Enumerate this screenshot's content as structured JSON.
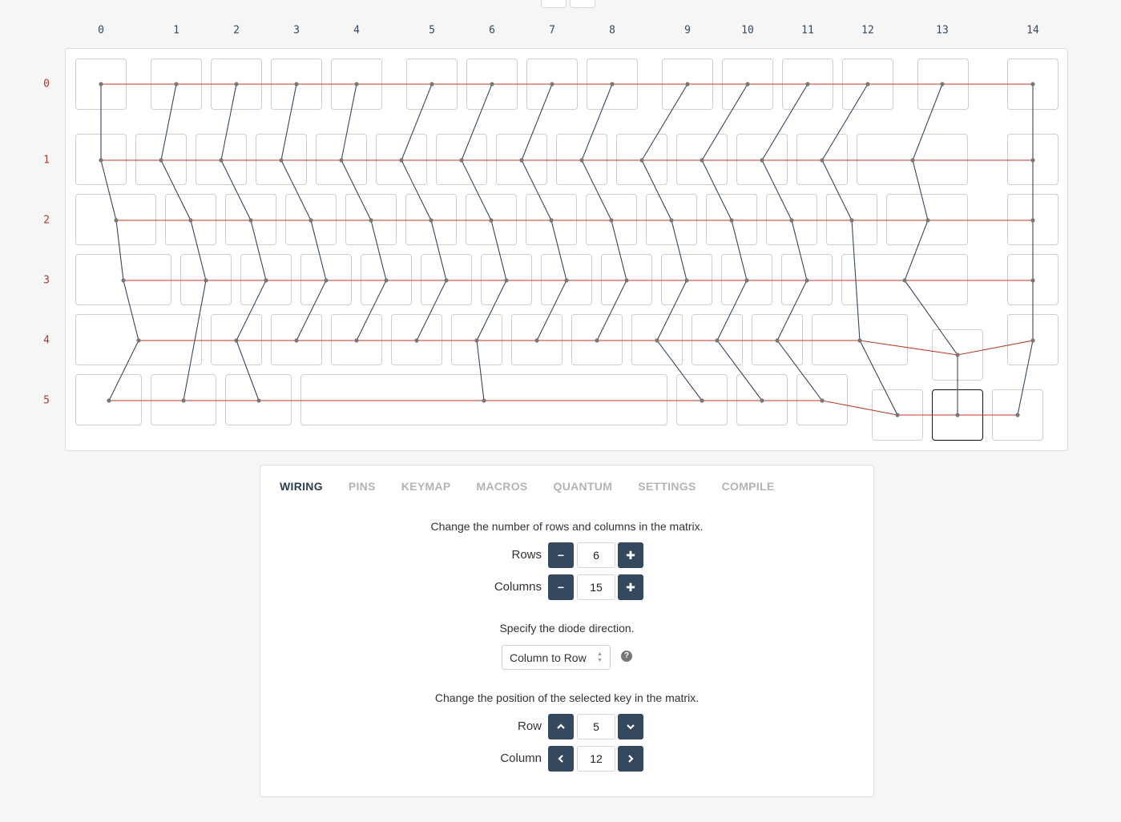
{
  "matrix": {
    "column_labels": [
      "0",
      "1",
      "2",
      "3",
      "4",
      "5",
      "6",
      "7",
      "8",
      "9",
      "10",
      "11",
      "12",
      "13",
      "14"
    ],
    "row_labels": [
      "0",
      "1",
      "2",
      "3",
      "4",
      "5"
    ]
  },
  "colors": {
    "row_wire": "#c0392b",
    "column_wire": "#34495e",
    "node": "#777777",
    "accent_button": "#34495e"
  },
  "tabs": [
    "WIRING",
    "PINS",
    "KEYMAP",
    "MACROS",
    "QUANTUM",
    "SETTINGS",
    "COMPILE"
  ],
  "active_tab": "WIRING",
  "wiring": {
    "matrix_size_text": "Change the number of rows and columns in the matrix.",
    "rows_label": "Rows",
    "rows_value": "6",
    "columns_label": "Columns",
    "columns_value": "15",
    "diode_text": "Specify the diode direction.",
    "diode_value": "Column to Row",
    "position_text": "Change the position of the selected key in the matrix.",
    "row_label": "Row",
    "row_value": "5",
    "column_label": "Column",
    "column_value": "12"
  },
  "icons": {
    "minus": "minus-icon",
    "plus": "plus-icon",
    "up": "chevron-up-icon",
    "down": "chevron-down-icon",
    "left": "chevron-left-icon",
    "right": "chevron-right-icon",
    "help": "question-circle-icon"
  }
}
